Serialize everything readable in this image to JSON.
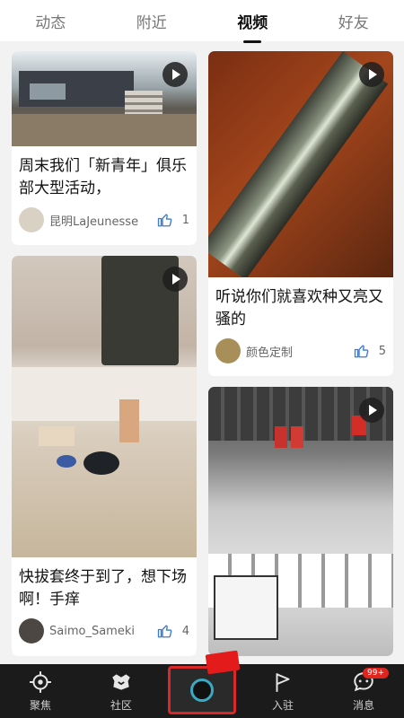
{
  "tabs": [
    {
      "label": "动态",
      "active": false
    },
    {
      "label": "附近",
      "active": false
    },
    {
      "label": "视频",
      "active": true
    },
    {
      "label": "好友",
      "active": false
    }
  ],
  "feed": {
    "left": [
      {
        "title": "周末我们「新青年」俱乐部大型活动，",
        "author": "昆明LaJeunesse",
        "likes": "1",
        "thumb_icon": "play-icon"
      },
      {
        "title": "快拔套终于到了，想下场啊！手痒",
        "author": "Saimo_Sameki",
        "likes": "4",
        "thumb_icon": "play-icon"
      }
    ],
    "right": [
      {
        "title": "听说你们就喜欢种又亮又骚的",
        "author": "颜色定制",
        "likes": "5",
        "thumb_icon": "play-icon"
      },
      {
        "title": "",
        "author": "",
        "likes": "",
        "thumb_icon": "play-icon"
      }
    ]
  },
  "bottom_nav": [
    {
      "label": "聚焦",
      "icon": "crosshair-icon"
    },
    {
      "label": "社区",
      "icon": "community-icon"
    },
    {
      "label": "",
      "icon": "camera-icon"
    },
    {
      "label": "入驻",
      "icon": "flag-icon"
    },
    {
      "label": "消息",
      "icon": "message-icon",
      "badge": "99+"
    }
  ],
  "colors": {
    "accent": "#d92828",
    "badge": "#e0251e",
    "bar": "#1b1b1b"
  }
}
